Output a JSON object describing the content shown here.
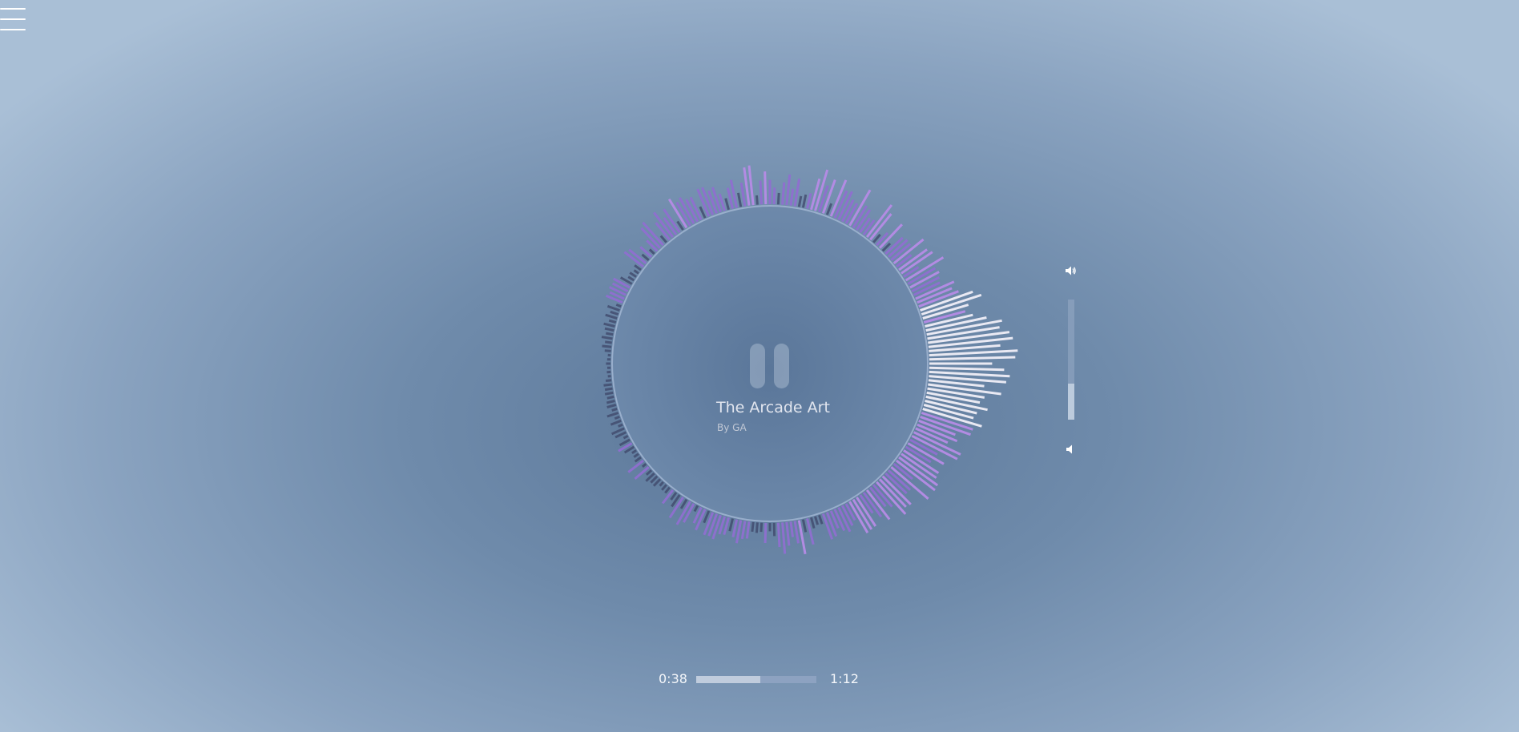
{
  "icons": {
    "menu": "hamburger-menu-icon",
    "pause": "pause-icon",
    "volume_up": "speaker-high-icon",
    "volume_down": "speaker-low-icon"
  },
  "track": {
    "title": "The Arcade Art",
    "artist": "By GA"
  },
  "playback": {
    "state": "playing",
    "current_time": "0:38",
    "total_time": "1:12",
    "progress": 0.53
  },
  "volume": {
    "level": 0.3
  },
  "visualizer": {
    "type": "circular-spectrum",
    "colors": {
      "low": "#3e4568",
      "mid": "#8f6fd0",
      "high": "#b68be6",
      "peak": "#f0eef7"
    }
  }
}
